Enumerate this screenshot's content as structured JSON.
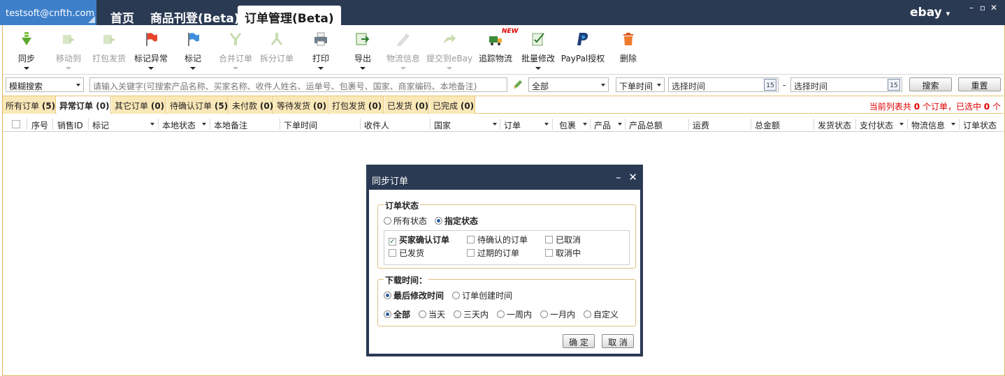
{
  "header": {
    "account": "testsoft@cnfth.com",
    "tabs": [
      {
        "label": "首页"
      },
      {
        "label": "商品刊登(Beta)"
      },
      {
        "label": "订单管理(Beta)"
      }
    ],
    "platform": "ebay",
    "platform_arrow": "▾",
    "window_controls": [
      "–",
      "▫",
      "✕"
    ]
  },
  "toolbar": {
    "items": [
      {
        "label": "同步",
        "icon": "sync-down-arrow-icon",
        "enabled": true,
        "dropdown": true
      },
      {
        "label": "移动到",
        "icon": "move-to-icon",
        "enabled": false,
        "dropdown": true
      },
      {
        "label": "打包发货",
        "icon": "pack-ship-icon",
        "enabled": false,
        "dropdown": false
      },
      {
        "label": "标记异常",
        "icon": "red-flag-icon",
        "enabled": true,
        "dropdown": true
      },
      {
        "label": "标记",
        "icon": "blue-flag-icon",
        "enabled": true,
        "dropdown": true
      },
      {
        "label": "合并订单",
        "icon": "merge-order-icon",
        "enabled": false,
        "dropdown": true
      },
      {
        "label": "拆分订单",
        "icon": "split-order-icon",
        "enabled": false,
        "dropdown": false
      },
      {
        "label": "打印",
        "icon": "printer-icon",
        "enabled": true,
        "dropdown": true
      },
      {
        "label": "导出",
        "icon": "export-icon",
        "enabled": true,
        "dropdown": true
      },
      {
        "label": "物流信息",
        "icon": "logistics-info-icon",
        "enabled": false,
        "dropdown": true
      },
      {
        "label": "提交到eBay",
        "icon": "submit-ebay-icon",
        "enabled": false,
        "dropdown": true
      },
      {
        "label": "追踪物流",
        "icon": "tracking-truck-icon",
        "enabled": true,
        "dropdown": false,
        "badge": "NEW"
      },
      {
        "label": "批量修改",
        "icon": "batch-edit-icon",
        "enabled": true,
        "dropdown": true
      },
      {
        "label": "PayPal授权",
        "icon": "paypal-icon",
        "enabled": true,
        "dropdown": false
      },
      {
        "label": "删除",
        "icon": "trash-icon",
        "enabled": true,
        "dropdown": false
      }
    ]
  },
  "search": {
    "mode": "模糊搜索",
    "keyword_placeholder": "请输入关键字(可搜索产品名称、买家名称、收件人姓名、运单号、包裹号、国家、商家编码、本地备注)",
    "scope": "全部",
    "time_type": "下单时间",
    "start_time": "选择时间",
    "end_time": "选择时间",
    "range_sep": "-",
    "calendar_day": "15",
    "search_button": "搜索",
    "reset_button": "重置"
  },
  "status_tabs": [
    {
      "label": "所有订单",
      "count": "(5)"
    },
    {
      "label": "异常订单",
      "count": "(0)"
    },
    {
      "label": "其它订单",
      "count": "(0)"
    },
    {
      "label": "待确认订单",
      "count": "(5)"
    },
    {
      "label": "未付款",
      "count": "(0)"
    },
    {
      "label": "等待发货",
      "count": "(0)"
    },
    {
      "label": "打包发货",
      "count": "(0)"
    },
    {
      "label": "已发货",
      "count": "(0)"
    },
    {
      "label": "已完成",
      "count": "(0)"
    }
  ],
  "summary": {
    "prefix": "当前列表共",
    "total": "0",
    "middle": "个订单，已选中",
    "selected": "0",
    "suffix": "个"
  },
  "columns": [
    "序号",
    "销售ID",
    "标记",
    "本地状态",
    "本地备注",
    "下单时间",
    "收件人",
    "国家",
    "订单",
    "包裹",
    "产品",
    "产品总额",
    "运费",
    "总金额",
    "发货状态",
    "支付状态",
    "物流信息",
    "订单状态"
  ],
  "dialog": {
    "title": "同步订单",
    "minimize": "–",
    "close": "✕",
    "order_status": {
      "legend": "订单状态",
      "radio_all": "所有状态",
      "radio_specified": "指定状态",
      "checkboxes": [
        {
          "label": "买家确认订单",
          "checked": true
        },
        {
          "label": "待确认的订单",
          "checked": false
        },
        {
          "label": "已取消",
          "checked": false
        },
        {
          "label": "已发货",
          "checked": false
        },
        {
          "label": "过期的订单",
          "checked": false
        },
        {
          "label": "取消中",
          "checked": false
        }
      ]
    },
    "download_time": {
      "legend": "下载时间：",
      "basis": [
        "最后修改时间",
        "订单创建时间"
      ],
      "ranges": [
        "全部",
        "当天",
        "三天内",
        "一周内",
        "一月内",
        "自定义"
      ]
    },
    "ok_button": "确 定",
    "cancel_button": "取 消"
  },
  "colors": {
    "header_bg": "#2b3a53",
    "account_bg": "#3d7fc9",
    "tab_bg": "#fbe8b8",
    "accent_border": "#e6c675",
    "alert_red": "#e00000"
  }
}
